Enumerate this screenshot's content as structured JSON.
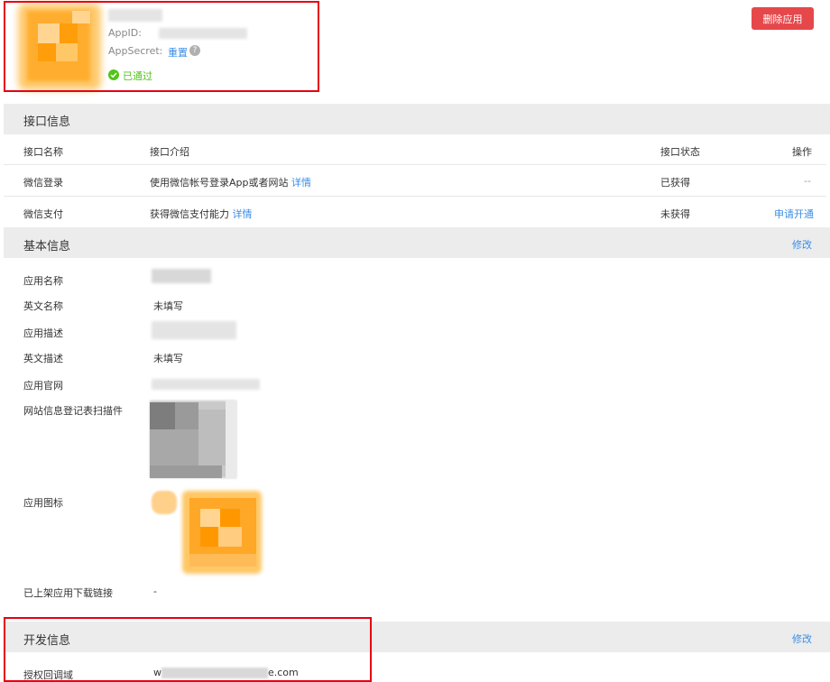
{
  "header": {
    "appid_label": "AppID:",
    "appsecret_label": "AppSecret:",
    "appsecret_action": "重置",
    "help_mark": "?",
    "status_text": "已通过",
    "delete_button": "删除应用"
  },
  "interface": {
    "title": "接口信息",
    "columns": {
      "name": "接口名称",
      "intro": "接口介绍",
      "status": "接口状态",
      "action": "操作"
    },
    "rows": [
      {
        "name": "微信登录",
        "intro": "使用微信帐号登录App或者网站",
        "detail": "详情",
        "status": "已获得",
        "action": "--"
      },
      {
        "name": "微信支付",
        "intro": "获得微信支付能力",
        "detail": "详情",
        "status": "未获得",
        "action": "申请开通"
      }
    ]
  },
  "basic": {
    "title": "基本信息",
    "edit": "修改",
    "app_name_label": "应用名称",
    "en_name_label": "英文名称",
    "en_name_value": "未填写",
    "app_desc_label": "应用描述",
    "en_desc_label": "英文描述",
    "en_desc_value": "未填写",
    "website_label": "应用官网",
    "scan_label": "网站信息登记表扫描件",
    "icon_label": "应用图标",
    "download_label": "已上架应用下载链接",
    "download_value": "-"
  },
  "dev": {
    "title": "开发信息",
    "edit": "修改",
    "callback_label": "授权回调域",
    "callback_prefix": "w",
    "callback_suffix": "e.com"
  },
  "colors": {
    "accent_link": "#3a8ee6",
    "danger": "#e6474a",
    "success": "#52c41a",
    "highlight_box": "#e60012",
    "section_bg": "#ececec",
    "icon_orange": "#ffa726"
  }
}
